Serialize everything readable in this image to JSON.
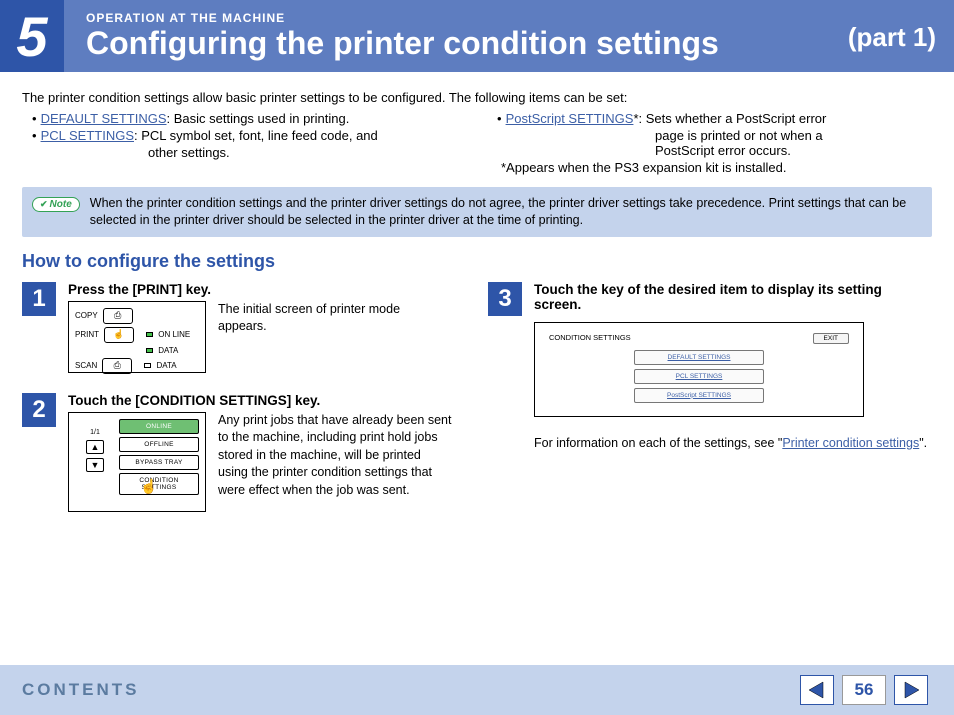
{
  "header": {
    "chapter_number": "5",
    "chapter_name": "OPERATION AT THE MACHINE",
    "title": "Configuring the printer condition settings",
    "part": "(part 1)"
  },
  "intro": "The printer condition settings allow basic printer settings to be configured. The following items can be set:",
  "bullets": {
    "left": [
      {
        "link": "DEFAULT SETTINGS",
        "desc": ": Basic settings used in printing."
      },
      {
        "link": "PCL SETTINGS",
        "desc": ": PCL symbol set, font, line feed code, and",
        "cont": "other settings."
      }
    ],
    "right": [
      {
        "link": "PostScript SETTINGS",
        "star": "*",
        "desc": ": Sets whether a PostScript error",
        "cont1": "page is printed or not when a",
        "cont2": "PostScript error occurs."
      }
    ],
    "asterisk_note": "*Appears when the PS3 expansion kit is installed."
  },
  "note": {
    "badge": "Note",
    "text": "When the printer condition settings and the printer driver settings do not agree, the printer driver settings take precedence. Print settings that can be selected in the printer driver should be selected in the printer driver at the time of printing."
  },
  "howto_heading": "How to configure the settings",
  "steps": {
    "s1": {
      "num": "1",
      "title": "Press the [PRINT] key.",
      "desc": "The initial screen of printer mode appears.",
      "panel": {
        "copy": "COPY",
        "print": "PRINT",
        "scan": "SCAN",
        "online": "ON LINE",
        "data1": "DATA",
        "data2": "DATA"
      }
    },
    "s2": {
      "num": "2",
      "title": "Touch the [CONDITION SETTINGS] key.",
      "desc": "Any print jobs that have already been sent to the machine, including print hold jobs stored in the machine, will be printed using the printer condition settings that were effect when the job was sent.",
      "panel": {
        "page": "1/1",
        "online": "ONLINE",
        "offline": "OFFLINE",
        "bypass": "BYPASS TRAY",
        "condition": "CONDITION SETTINGS"
      }
    },
    "s3": {
      "num": "3",
      "title": "Touch the key of the desired item to display its setting screen.",
      "panel": {
        "heading": "CONDITION SETTINGS",
        "exit": "EXIT",
        "b1": "DEFAULT SETTINGS",
        "b2": "PCL SETTINGS",
        "b3": "PostScript SETTINGS"
      },
      "info_pre": "For information on each of the settings, see \"",
      "info_link": "Printer condition settings",
      "info_post": "\"."
    }
  },
  "footer": {
    "contents": "CONTENTS",
    "page_num": "56"
  }
}
